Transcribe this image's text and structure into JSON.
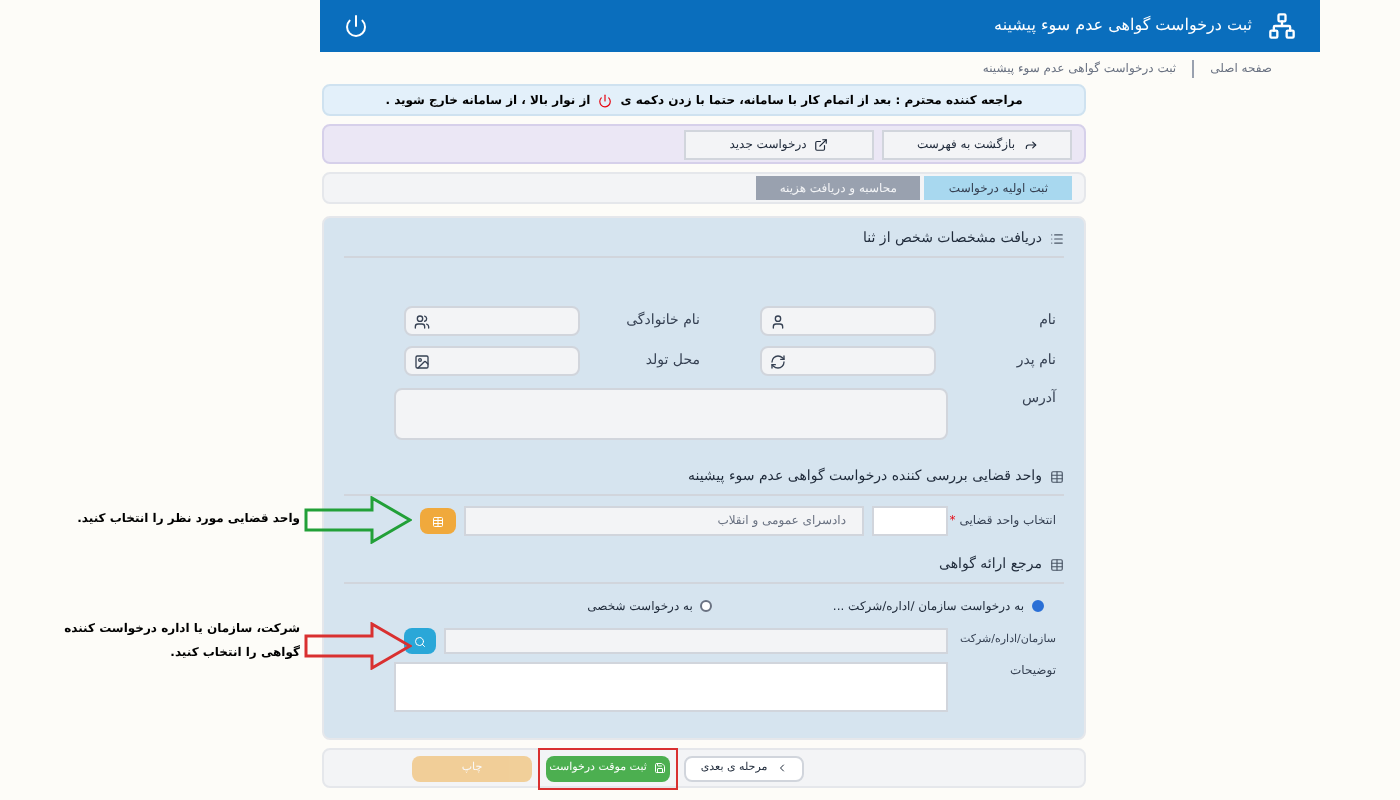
{
  "header": {
    "title": "ثبت درخواست گواهی عدم سوء پیشینه"
  },
  "breadcrumb": [
    {
      "label": "صفحه اصلی"
    },
    {
      "label": "ثبت درخواست گواهی عدم سوء پیشینه"
    }
  ],
  "alert": {
    "before": "مراجعه کننده محترم : بعد از اتمام کار با سامانه، حتما با زدن دکمه ی",
    "after": "از نوار بالا ، از سامانه خارج شوید ."
  },
  "toolbar": [
    "بازگشت به فهرست",
    "درخواست جدید"
  ],
  "steps": [
    {
      "label": "ثبت اولیه درخواست",
      "selected": true
    },
    {
      "label": "محاسبه و دریافت هزینه",
      "selected": false
    }
  ],
  "personal": {
    "title": "دریافت مشخصات شخص از ثنا",
    "fields": [
      "نام",
      "نام خانوادگی",
      "نام پدر",
      "محل تولد"
    ],
    "address_label": "آدرس"
  },
  "court": {
    "title": "واحد قضایی بررسی کننده درخواست گواهی عدم سوء پیشینه",
    "label": "انتخاب واحد قضایی",
    "required_mark": "*",
    "value": "دادسرای عمومی و انقلاب"
  },
  "reference": {
    "title": "مرجع ارائه گواهی",
    "options": [
      {
        "label": "به درخواست سازمان /اداره/شرکت ...",
        "selected": true
      },
      {
        "label": "به درخواست شخصی",
        "selected": false
      }
    ],
    "org_label": "سازمان/اداره/شرکت",
    "notes_label": "توضیحات"
  },
  "actions": [
    {
      "label": "مرحله ی بعدی",
      "kind": "next",
      "disabled": false,
      "highlighted": false
    },
    {
      "label": "ثبت موقت درخواست",
      "kind": "save",
      "disabled": false,
      "highlighted": true
    },
    {
      "label": "چاپ",
      "kind": "print",
      "disabled": true,
      "highlighted": false
    }
  ],
  "annotations": [
    {
      "text": "واحد قضایی مورد نظر را انتخاب کنید.",
      "color": "#22a038"
    },
    {
      "text": "شرکت، سازمان یا اداره درخواست کننده گواهی را انتخاب کنید.",
      "color": "#d93030"
    }
  ]
}
